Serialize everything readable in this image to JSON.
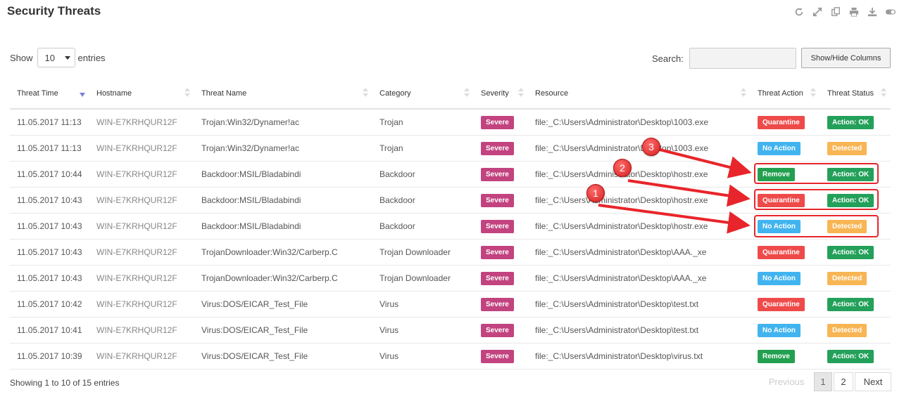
{
  "title": "Security Threats",
  "toolbar_icons": [
    "refresh-icon",
    "expand-icon",
    "copy-icon",
    "print-icon",
    "download-icon",
    "toggle-icon"
  ],
  "length": {
    "show_label": "Show",
    "value": "10",
    "entries_label": "entries"
  },
  "search": {
    "label": "Search:",
    "value": ""
  },
  "showhide_label": "Show/Hide Columns",
  "columns": [
    "Threat Time",
    "Hostname",
    "Threat Name",
    "Category",
    "Severity",
    "Resource",
    "Threat Action",
    "Threat Status"
  ],
  "rows": [
    {
      "time": "11.05.2017 11:13",
      "host": "WIN-E7KRHQUR12F",
      "name": "Trojan:Win32/Dynamer!ac",
      "category": "Trojan",
      "severity": "Severe",
      "resource": "file:_C:\\Users\\Administrator\\Desktop\\1003.exe",
      "action": "Quarantine",
      "status": "Action: OK"
    },
    {
      "time": "11.05.2017 11:13",
      "host": "WIN-E7KRHQUR12F",
      "name": "Trojan:Win32/Dynamer!ac",
      "category": "Trojan",
      "severity": "Severe",
      "resource": "file:_C:\\Users\\Administrator\\Desktop\\1003.exe",
      "action": "No Action",
      "status": "Detected"
    },
    {
      "time": "11.05.2017 10:44",
      "host": "WIN-E7KRHQUR12F",
      "name": "Backdoor:MSIL/Bladabindi",
      "category": "Backdoor",
      "severity": "Severe",
      "resource": "file:_C:\\Users\\Administrator\\Desktop\\hostr.exe",
      "action": "Remove",
      "status": "Action: OK"
    },
    {
      "time": "11.05.2017 10:43",
      "host": "WIN-E7KRHQUR12F",
      "name": "Backdoor:MSIL/Bladabindi",
      "category": "Backdoor",
      "severity": "Severe",
      "resource": "file:_C:\\Users\\Administrator\\Desktop\\hostr.exe",
      "action": "Quarantine",
      "status": "Action: OK"
    },
    {
      "time": "11.05.2017 10:43",
      "host": "WIN-E7KRHQUR12F",
      "name": "Backdoor:MSIL/Bladabindi",
      "category": "Backdoor",
      "severity": "Severe",
      "resource": "file:_C:\\Users\\Administrator\\Desktop\\hostr.exe",
      "action": "No Action",
      "status": "Detected"
    },
    {
      "time": "11.05.2017 10:43",
      "host": "WIN-E7KRHQUR12F",
      "name": "TrojanDownloader:Win32/Carberp.C",
      "category": "Trojan Downloader",
      "severity": "Severe",
      "resource": "file:_C:\\Users\\Administrator\\Desktop\\AAA._xe",
      "action": "Quarantine",
      "status": "Action: OK"
    },
    {
      "time": "11.05.2017 10:43",
      "host": "WIN-E7KRHQUR12F",
      "name": "TrojanDownloader:Win32/Carberp.C",
      "category": "Trojan Downloader",
      "severity": "Severe",
      "resource": "file:_C:\\Users\\Administrator\\Desktop\\AAA._xe",
      "action": "No Action",
      "status": "Detected"
    },
    {
      "time": "11.05.2017 10:42",
      "host": "WIN-E7KRHQUR12F",
      "name": "Virus:DOS/EICAR_Test_File",
      "category": "Virus",
      "severity": "Severe",
      "resource": "file:_C:\\Users\\Administrator\\Desktop\\test.txt",
      "action": "Quarantine",
      "status": "Action: OK"
    },
    {
      "time": "11.05.2017 10:41",
      "host": "WIN-E7KRHQUR12F",
      "name": "Virus:DOS/EICAR_Test_File",
      "category": "Virus",
      "severity": "Severe",
      "resource": "file:_C:\\Users\\Administrator\\Desktop\\test.txt",
      "action": "No Action",
      "status": "Detected"
    },
    {
      "time": "11.05.2017 10:39",
      "host": "WIN-E7KRHQUR12F",
      "name": "Virus:DOS/EICAR_Test_File",
      "category": "Virus",
      "severity": "Severe",
      "resource": "file:_C:\\Users\\Administrator\\Desktop\\virus.txt",
      "action": "Remove",
      "status": "Action: OK"
    }
  ],
  "footer": {
    "info": "Showing 1 to 10 of 15 entries",
    "previous": "Previous",
    "page1": "1",
    "page2": "2",
    "next": "Next"
  },
  "annotations": {
    "callouts": [
      "1",
      "2",
      "3"
    ],
    "color": "#e8252a"
  }
}
